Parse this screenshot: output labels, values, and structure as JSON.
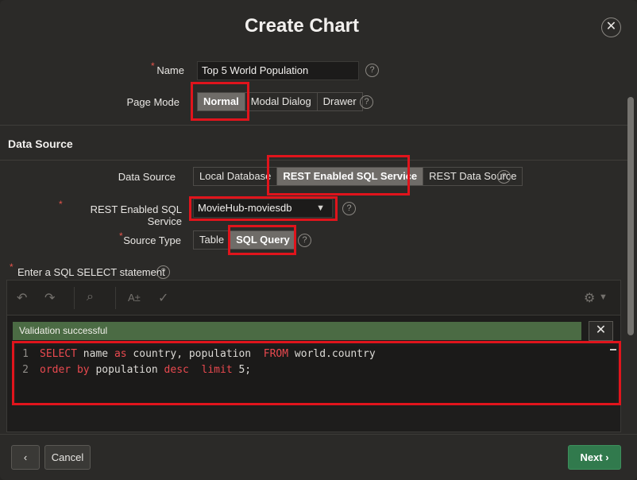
{
  "dialog": {
    "title": "Create Chart",
    "close_glyph": "✕"
  },
  "form": {
    "name": {
      "label": "Name",
      "value": "Top 5 World Population"
    },
    "page_mode": {
      "label": "Page Mode",
      "options": [
        "Normal",
        "Modal Dialog",
        "Drawer"
      ],
      "selected": "Normal"
    },
    "help_glyph": "?",
    "required_glyph": "*"
  },
  "data_source_section": {
    "title": "Data Source",
    "data_source": {
      "label": "Data Source",
      "options": [
        "Local Database",
        "REST Enabled SQL Service",
        "REST Data Source"
      ],
      "selected": "REST Enabled SQL Service"
    },
    "rest_service": {
      "label": "REST Enabled SQL Service",
      "value": "MovieHub-moviesdb"
    },
    "source_type": {
      "label": "Source Type",
      "options": [
        "Table",
        "SQL Query"
      ],
      "selected": "SQL Query"
    },
    "sql_label": "Enter a SQL SELECT statement"
  },
  "editor": {
    "validation_message": "Validation successful",
    "close_glyph": "✕",
    "line_numbers": [
      "1",
      "2"
    ],
    "line1": {
      "kw1": "SELECT",
      "t1": " name ",
      "kw2": "as",
      "t2": " country, population  ",
      "kw3": "FROM",
      "t3": " world.country"
    },
    "line2": {
      "kw1": "order by",
      "t1": " population ",
      "kw2": "desc",
      "t2": "  ",
      "kw3": "limit",
      "t3": " 5;"
    }
  },
  "footer": {
    "back_glyph": "‹",
    "cancel_label": "Cancel",
    "next_label": "Next ›"
  },
  "colors": {
    "accent_green": "#317a4d",
    "highlight_red": "#e0141c",
    "validation_bg": "#4b6b44",
    "keyword_red": "#e9494f"
  }
}
